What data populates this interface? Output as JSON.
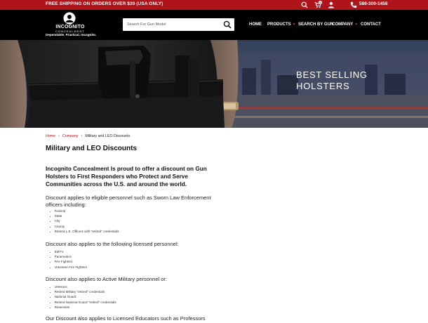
{
  "topbar": {
    "promo": "FREE SHIPPING ON ORDERS OVER $39 (USA ONLY)",
    "cart_count": "0",
    "phone": "586-300-1458",
    "bg_color": "#b0141b"
  },
  "header": {
    "logo": {
      "name": "INCOGNITO",
      "sub": "CONCEALMENT",
      "tagline": "Dependable. Practical. Incognito."
    },
    "search": {
      "placeholder": "Search For Gun Model"
    },
    "nav": {
      "home": "HOME",
      "products": "PRODUCTS",
      "search_by_gun": "SEARCH BY GUN",
      "company": "COMPANY",
      "contact": "CONTACT"
    }
  },
  "hero": {
    "line1": "BEST SELLING",
    "line2": "HOLSTERS"
  },
  "breadcrumb": {
    "home": "Home",
    "company": "Company",
    "current": "Military and LEO Discounts"
  },
  "page": {
    "title": "Military and LEO Discounts",
    "lead": "Incognito Concealment Is proud to offer a discount on Gun Holsters to First Responders who Protect and Serve Communities across the U.S. and around the world.",
    "section1": {
      "intro": "Discount applies to eligible personnel such as Sworn Law Enforcement officers including:",
      "items": [
        "Federal",
        "State",
        "City",
        "County",
        "Retired L.E. Officers with \"retired\" credentials"
      ]
    },
    "section2": {
      "intro": "Discount also applies to the following licensed personnel:",
      "items": [
        "EMT's",
        "Paramedics",
        "Fire Fighters",
        "Volunteer Fire Fighters"
      ]
    },
    "section3": {
      "intro": "Discount also applies to Active Military personnel or:",
      "items": [
        "Veterans",
        "Retired Military \"retired\" credentials",
        "National Guard",
        "Retired National Guard \"retired\" credentials",
        "Reservists"
      ]
    },
    "section4": {
      "intro": "Our Discount also applies to Licensed Educators such as Professors"
    }
  }
}
